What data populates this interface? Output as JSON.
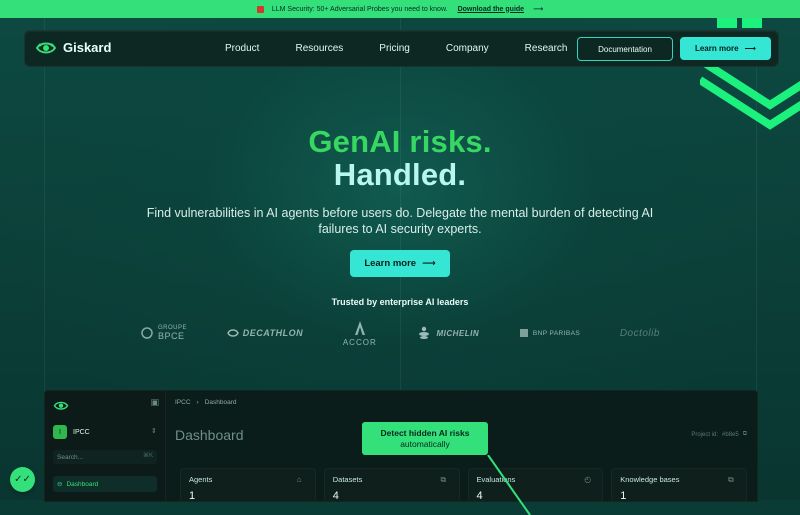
{
  "top_banner": {
    "text": "LLM Security: 50+ Adversarial Probes you need to know.",
    "link": "Download the guide",
    "arrow": "⟶"
  },
  "nav": {
    "brand": "Giskard",
    "items": [
      {
        "label": "Product"
      },
      {
        "label": "Resources"
      },
      {
        "label": "Pricing"
      },
      {
        "label": "Company"
      },
      {
        "label": "Research"
      }
    ],
    "documentation": "Documentation",
    "learn_more": "Learn more",
    "learn_more_arrow": "⟶"
  },
  "hero": {
    "line1": "GenAI risks.",
    "line2": "Handled.",
    "subtitle": "Find vulnerabilities in AI agents before users do. Delegate the mental burden of detecting AI failures to AI security experts.",
    "cta": "Learn more",
    "cta_arrow": "⟶"
  },
  "trusted": {
    "label": "Trusted by enterprise AI leaders",
    "logos": {
      "bpce_top": "GROUPE",
      "bpce_bottom": "BPCE",
      "decathlon": "DECATHLON",
      "accor": "ACCOR",
      "michelin": "MICHELIN",
      "bnp": "BNP PARIBAS",
      "doctolib": "Doctolib"
    }
  },
  "dashboard": {
    "org": "IPCC",
    "org_initial": "I",
    "search_placeholder": "Search...",
    "search_shortcut": "⌘K",
    "nav_dashboard": "Dashboard",
    "breadcrumb": [
      "IPCC",
      "Dashboard"
    ],
    "title": "Dashboard",
    "project_id_label": "Project id:",
    "project_id": "#b8e5",
    "cards": [
      {
        "label": "Agents",
        "value": "1",
        "icon": "agents-icon"
      },
      {
        "label": "Datasets",
        "value": "4",
        "icon": "datasets-icon"
      },
      {
        "label": "Evaluations",
        "value": "4",
        "icon": "evaluations-icon"
      },
      {
        "label": "Knowledge bases",
        "value": "1",
        "icon": "knowledge-icon"
      }
    ]
  },
  "callout": {
    "line1": "Detect hidden AI risks",
    "line2": "automatically"
  },
  "colors": {
    "accent_green": "#34e07a",
    "accent_cyan": "#36e6d5",
    "bg_dark": "#0a3b34",
    "title_green": "#36d862",
    "title_cyan": "#b9f6ef"
  }
}
